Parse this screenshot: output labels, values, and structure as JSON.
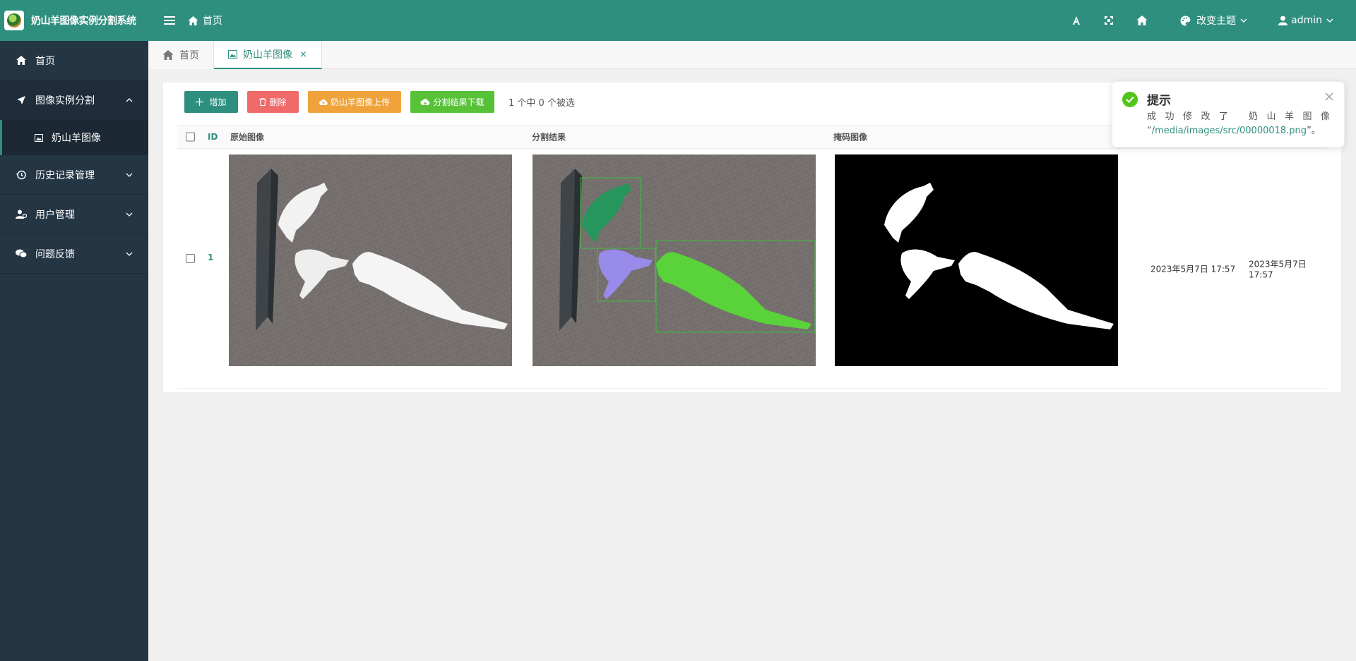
{
  "app": {
    "title": "奶山羊图像实例分割系统"
  },
  "sidebar": {
    "items": [
      {
        "label": "首页",
        "icon": "home-icon"
      },
      {
        "label": "图像实例分割",
        "icon": "send-icon",
        "expanded": true,
        "children": [
          {
            "label": "奶山羊图像",
            "icon": "image-icon",
            "active": true
          }
        ]
      },
      {
        "label": "历史记录管理",
        "icon": "history-icon"
      },
      {
        "label": "用户管理",
        "icon": "user-manage-icon"
      },
      {
        "label": "问题反馈",
        "icon": "feedback-icon"
      }
    ]
  },
  "header": {
    "breadcrumb": "首页",
    "theme_label": "改变主题",
    "user_label": "admin",
    "accent_color": "#2f8f7f"
  },
  "tabs": [
    {
      "label": "首页",
      "active": false
    },
    {
      "label": "奶山羊图像",
      "active": true,
      "close": "×"
    }
  ],
  "toolbar": {
    "add_label": "增加",
    "delete_label": "删除",
    "upload_label": "奶山羊图像上传",
    "download_label": "分割结果下载",
    "selection_info": "1 个中 0 个被选"
  },
  "table": {
    "columns": [
      "ID",
      "原始图像",
      "分割结果",
      "掩码图像"
    ],
    "rows": [
      {
        "id": "1",
        "created": "2023年5月7日 17:57",
        "updated": "2023年5月7日 17:57"
      }
    ]
  },
  "toast": {
    "title": "提示",
    "message_line1": "成功修改了 奶山羊图像",
    "quote_open": "“",
    "path": "/media/images/src/00000018.png",
    "quote_close": "”。"
  }
}
